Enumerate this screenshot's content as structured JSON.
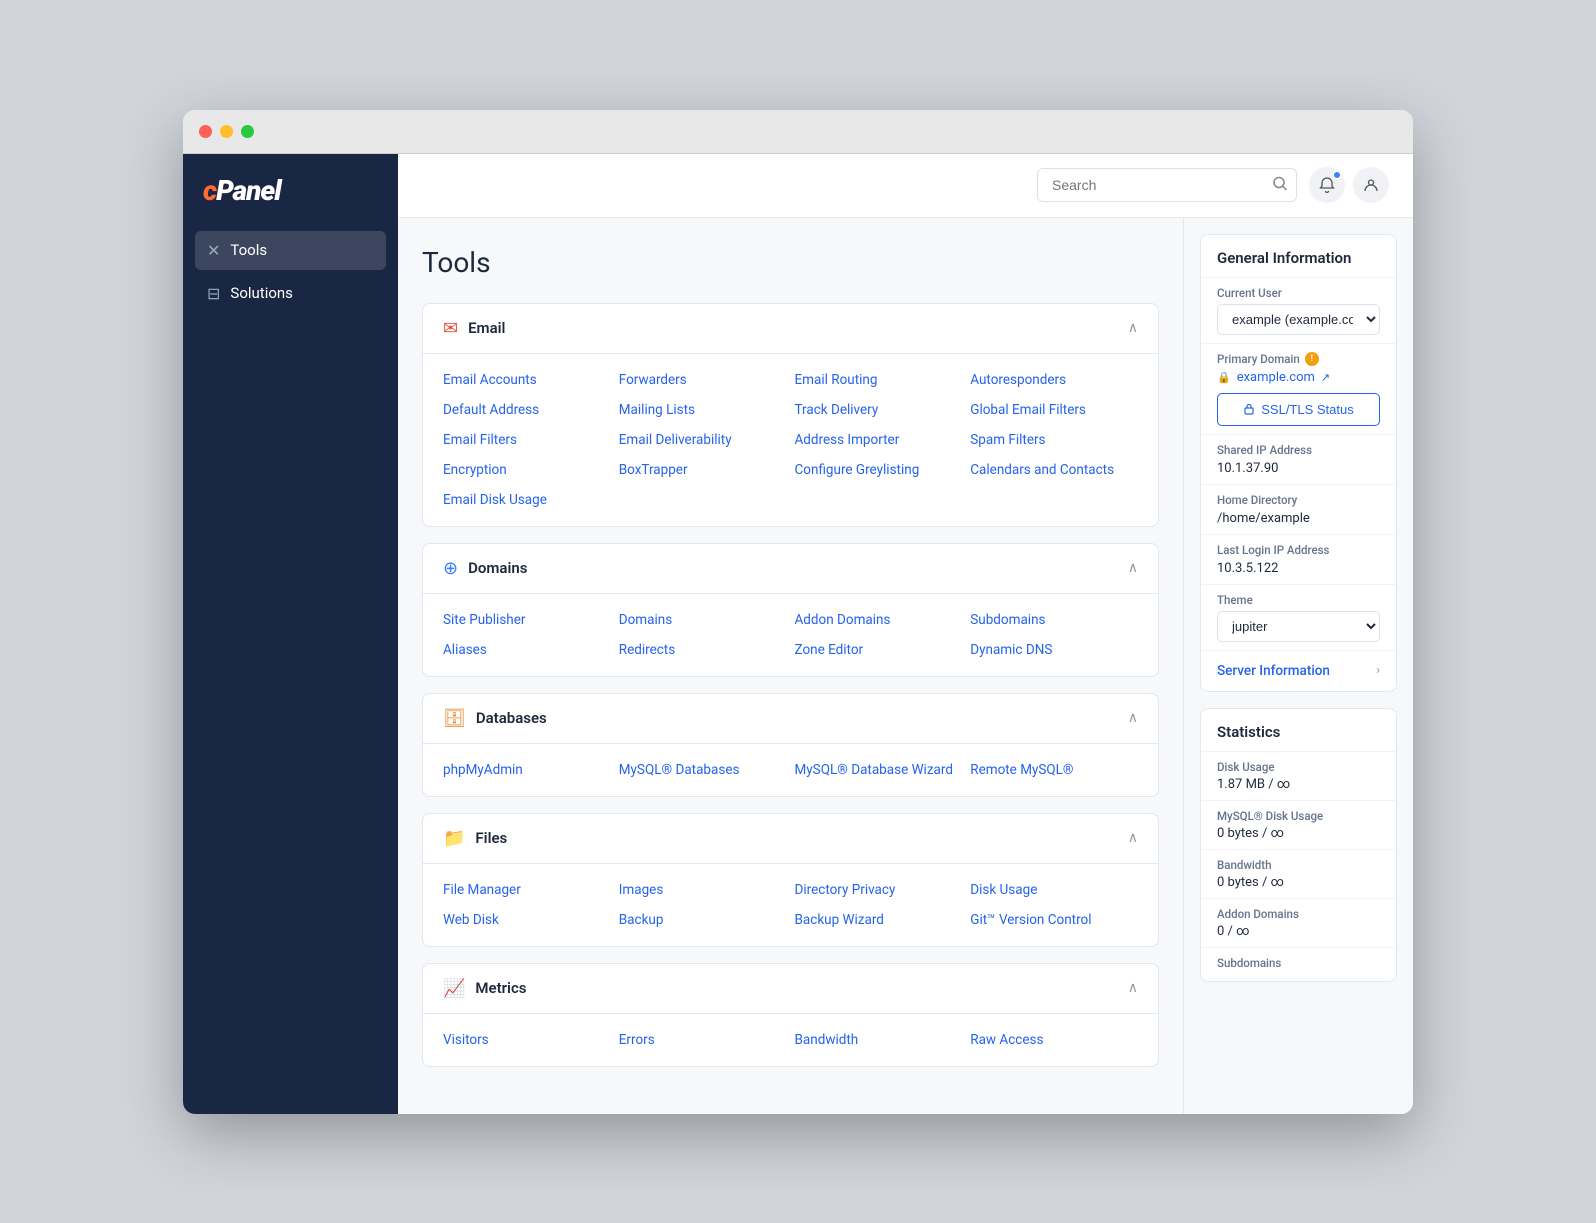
{
  "window": {
    "title": "cPanel"
  },
  "logo": {
    "text": "cPanel"
  },
  "sidebar": {
    "items": [
      {
        "id": "tools",
        "label": "Tools",
        "icon": "✕",
        "active": true
      },
      {
        "id": "solutions",
        "label": "Solutions",
        "icon": "⊟",
        "active": false
      }
    ]
  },
  "topbar": {
    "search": {
      "placeholder": "Search",
      "value": ""
    }
  },
  "page": {
    "title": "Tools"
  },
  "sections": [
    {
      "id": "email",
      "title": "Email",
      "iconType": "email",
      "collapsed": false,
      "links": [
        "Email Accounts",
        "Forwarders",
        "Email Routing",
        "Autoresponders",
        "Default Address",
        "Mailing Lists",
        "Track Delivery",
        "Global Email Filters",
        "Email Filters",
        "Email Deliverability",
        "Address Importer",
        "Spam Filters",
        "Encryption",
        "BoxTrapper",
        "Configure Greylisting",
        "Calendars and Contacts",
        "Email Disk Usage"
      ]
    },
    {
      "id": "domains",
      "title": "Domains",
      "iconType": "domains",
      "collapsed": false,
      "links": [
        "Site Publisher",
        "Domains",
        "Addon Domains",
        "Subdomains",
        "Aliases",
        "Redirects",
        "Zone Editor",
        "Dynamic DNS"
      ]
    },
    {
      "id": "databases",
      "title": "Databases",
      "iconType": "databases",
      "collapsed": false,
      "links": [
        "phpMyAdmin",
        "MySQL® Databases",
        "MySQL® Database Wizard",
        "Remote MySQL®"
      ]
    },
    {
      "id": "files",
      "title": "Files",
      "iconType": "files",
      "collapsed": false,
      "links": [
        "File Manager",
        "Images",
        "Directory Privacy",
        "Disk Usage",
        "Web Disk",
        "Backup",
        "Backup Wizard",
        "Git™ Version Control"
      ]
    },
    {
      "id": "metrics",
      "title": "Metrics",
      "iconType": "metrics",
      "collapsed": false,
      "links": [
        "Visitors",
        "Errors",
        "Bandwidth",
        "Raw Access"
      ]
    }
  ],
  "general_info": {
    "title": "General Information",
    "current_user_label": "Current User",
    "current_user_value": "example (example.com)",
    "current_user_options": [
      "example (example.com)"
    ],
    "primary_domain_label": "Primary Domain",
    "primary_domain_value": "example.com",
    "ssl_button_label": "SSL/TLS Status",
    "shared_ip_label": "Shared IP Address",
    "shared_ip_value": "10.1.37.90",
    "home_dir_label": "Home Directory",
    "home_dir_value": "/home/example",
    "last_login_label": "Last Login IP Address",
    "last_login_value": "10.3.5.122",
    "theme_label": "Theme",
    "theme_value": "jupiter",
    "theme_options": [
      "jupiter"
    ],
    "server_info_label": "Server Information"
  },
  "statistics": {
    "title": "Statistics",
    "items": [
      {
        "label": "Disk Usage",
        "value": "1.87 MB / ∞"
      },
      {
        "label": "MySQL® Disk Usage",
        "value": "0 bytes / ∞"
      },
      {
        "label": "Bandwidth",
        "value": "0 bytes / ∞"
      },
      {
        "label": "Addon Domains",
        "value": "0 / ∞"
      },
      {
        "label": "Subdomains",
        "value": ""
      }
    ]
  }
}
